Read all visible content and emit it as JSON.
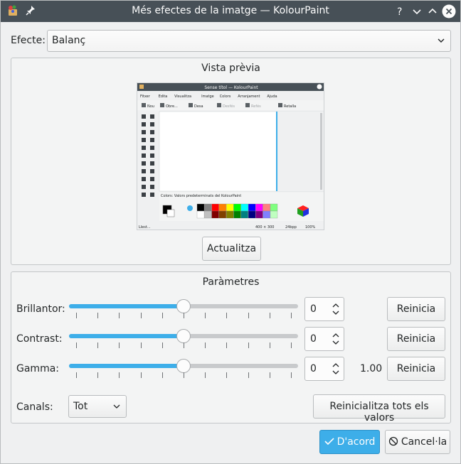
{
  "window": {
    "title": "Més efectes de la imatge — KolourPaint"
  },
  "effect": {
    "label": "Efecte:",
    "selected": "Balanç"
  },
  "preview": {
    "title": "Vista prèvia",
    "update_label": "Actualitza",
    "mini": {
      "title": "Sense títol — KolourPaint",
      "menus": [
        "Fitxer",
        "Edita",
        "Visualitza",
        "Imatge",
        "Colors",
        "Arranjament",
        "Ajuda"
      ],
      "toolbar": [
        "Nou",
        "Obre...",
        "Desa",
        "Desfés",
        "Refés",
        "Retalla"
      ],
      "colors_label": "Colors: Valors predeterminats del KolourPaint",
      "status_left": "Llest...",
      "status_size": "400 × 300",
      "status_bpp": "24bpp",
      "status_zoom": "100%",
      "palette": [
        "#000000",
        "#808080",
        "#ff0000",
        "#ff8000",
        "#ffff00",
        "#00ff00",
        "#00ffff",
        "#0000ff",
        "#ff00ff",
        "#ff8080",
        "#80ff80",
        "#ffffff",
        "#c0c0c0",
        "#800000",
        "#804000",
        "#808000",
        "#008000",
        "#008080",
        "#000080",
        "#800080",
        "#8080ff",
        "#c0ffc0"
      ]
    }
  },
  "params": {
    "title": "Paràmetres",
    "rows": [
      {
        "label": "Brillantor:",
        "value": "0",
        "reset": "Reinicia",
        "extra": "",
        "position": 0.5
      },
      {
        "label": "Contrast:",
        "value": "0",
        "reset": "Reinicia",
        "extra": "",
        "position": 0.5
      },
      {
        "label": "Gamma:",
        "value": "0",
        "reset": "Reinicia",
        "extra": "1.00",
        "position": 0.5
      }
    ],
    "channels_label": "Canals:",
    "channels_selected": "Tot",
    "reset_all": "Reinicialitza tots els valors"
  },
  "footer": {
    "ok": "D'acord",
    "cancel": "Cancel·la"
  },
  "colors": {
    "accent": "#3daee9",
    "titlebar": "#475057"
  }
}
